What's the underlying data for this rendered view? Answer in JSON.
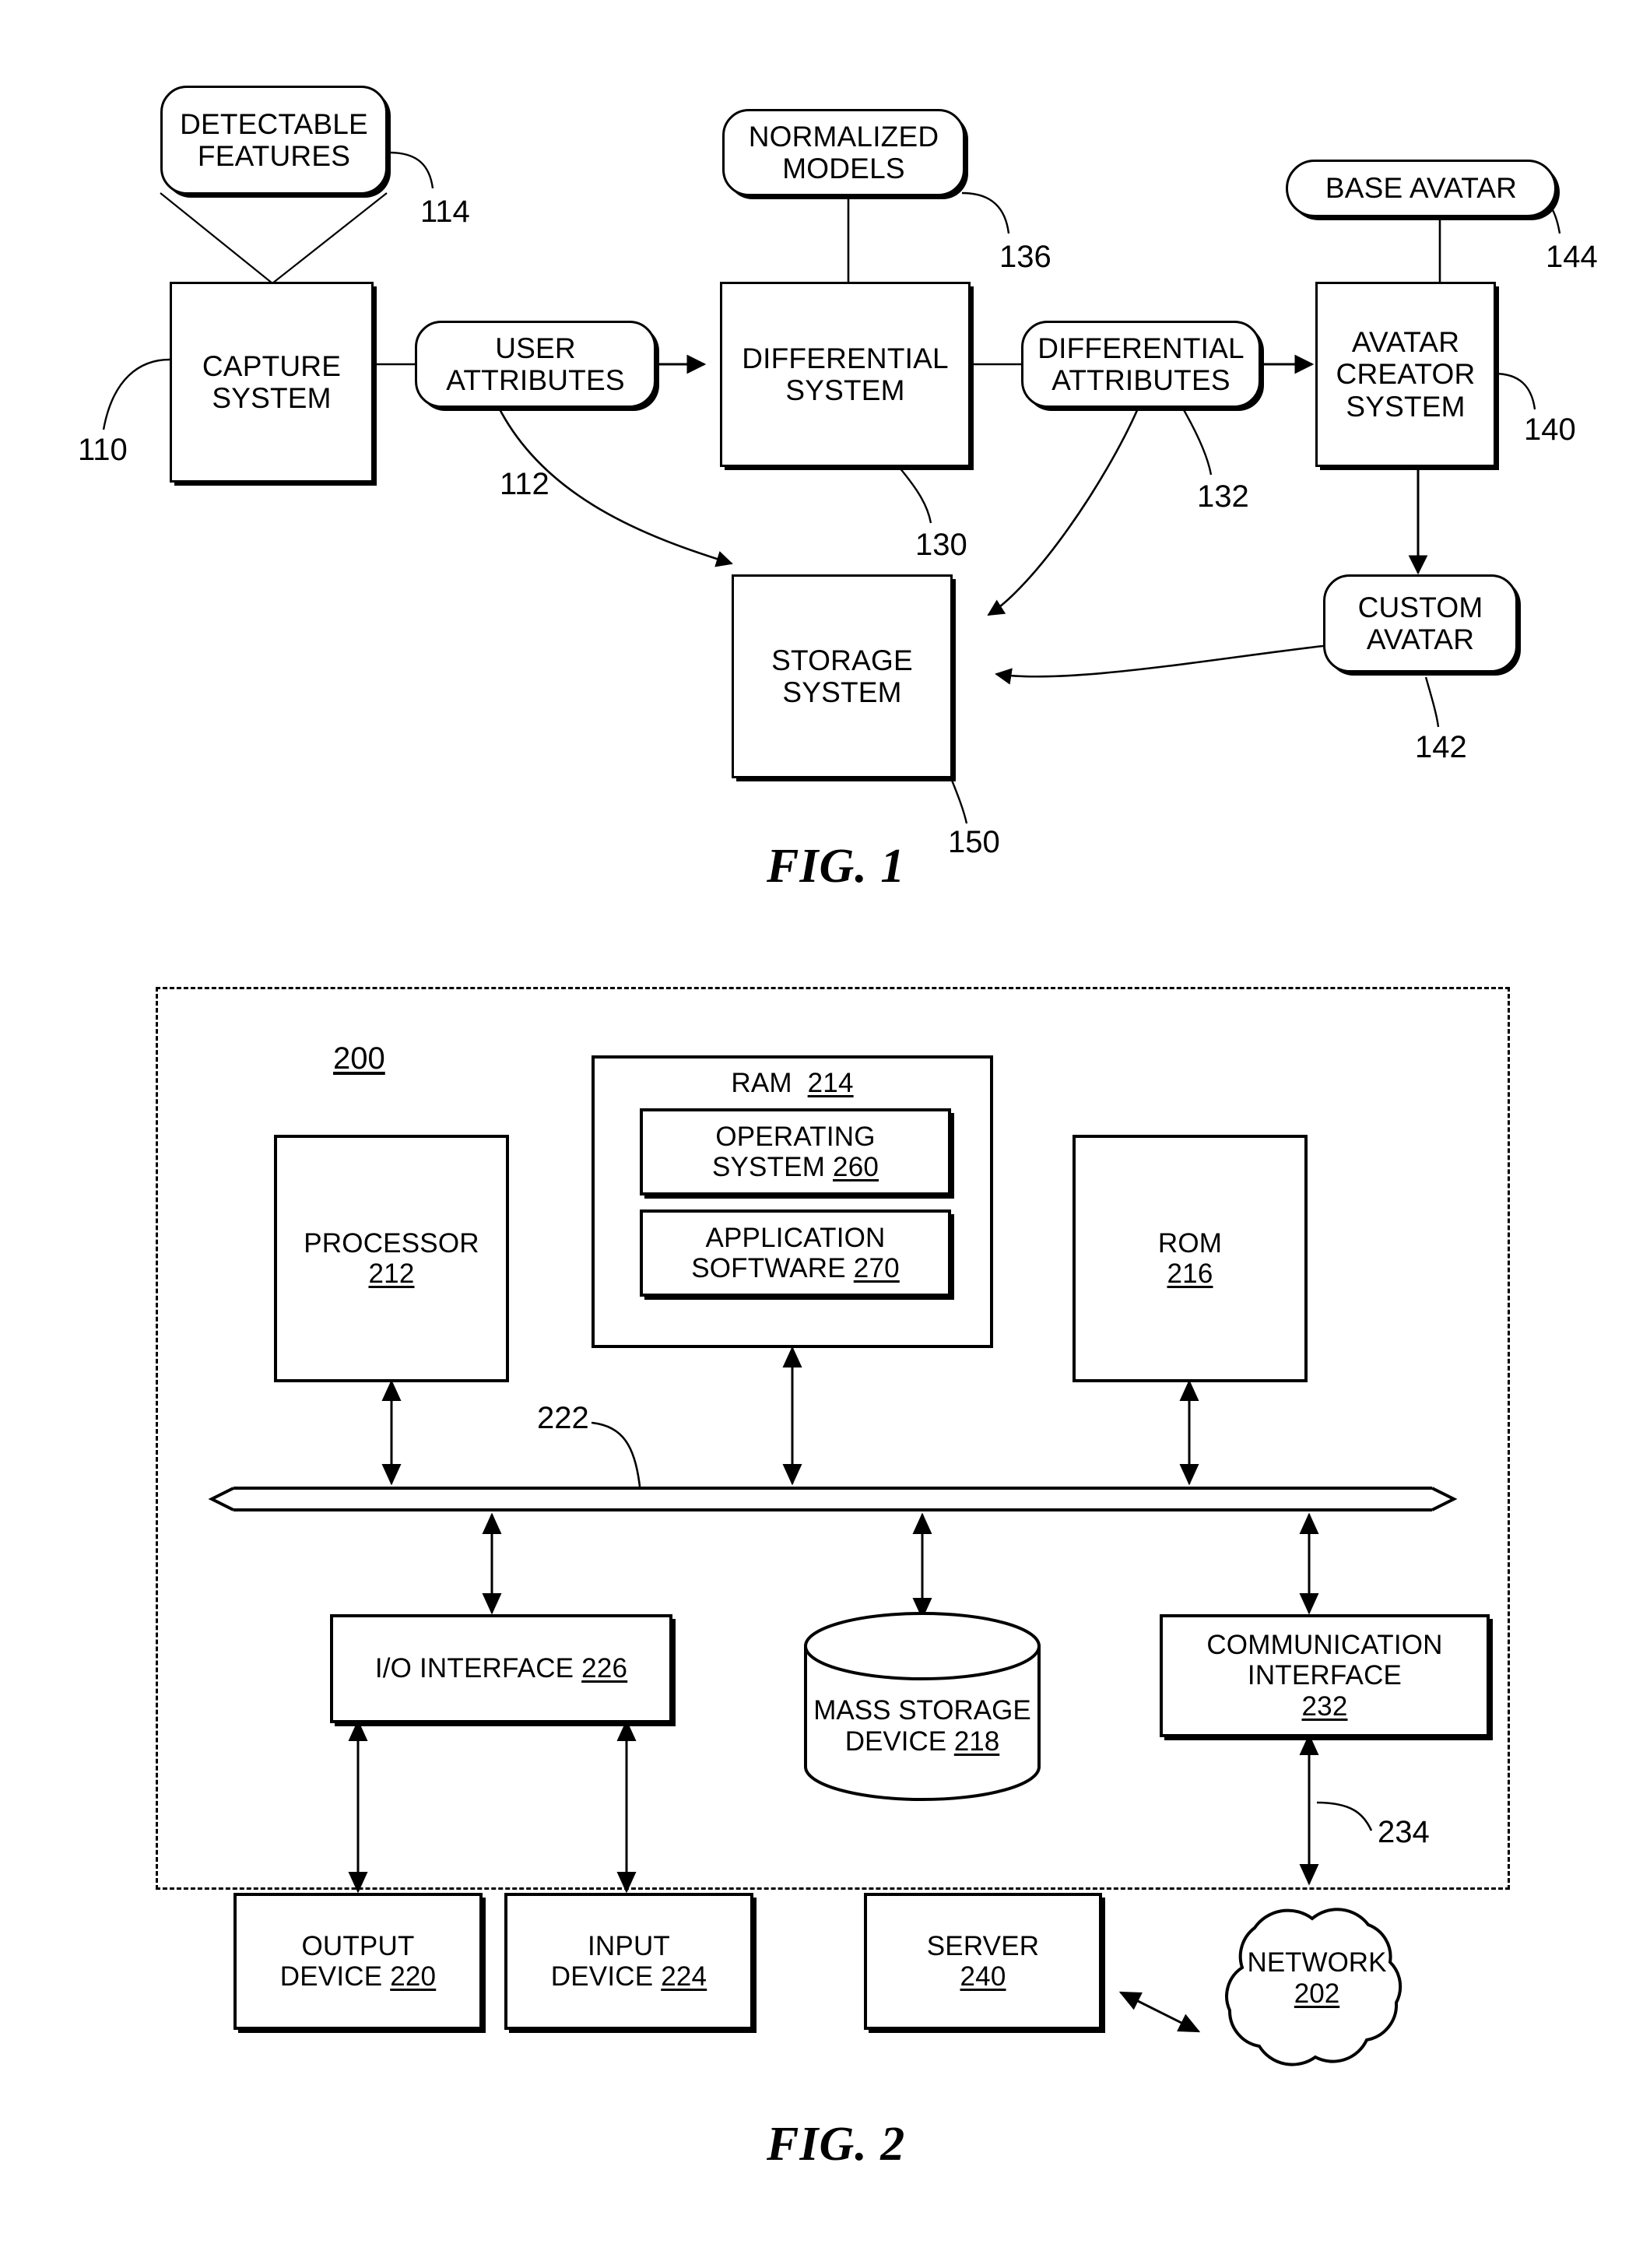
{
  "document": {
    "type": "patent-drawing-sheet",
    "figures": [
      {
        "caption": "FIG. 1",
        "title": "Avatar generation system block diagram"
      },
      {
        "caption": "FIG. 2",
        "title": "Computing device block diagram"
      }
    ]
  },
  "fig1": {
    "caption": "FIG. 1",
    "nodes": {
      "detectable_features": {
        "label": "DETECTABLE FEATURES",
        "line1": "DETECTABLE",
        "line2": "FEATURES",
        "ref": "114",
        "shape": "rounded-callout"
      },
      "capture_system": {
        "label": "CAPTURE SYSTEM",
        "line1": "CAPTURE",
        "line2": "SYSTEM",
        "ref": "110",
        "shape": "rect"
      },
      "user_attributes": {
        "label": "USER ATTRIBUTES",
        "line1": "USER",
        "line2": "ATTRIBUTES",
        "ref": "112",
        "shape": "rounded"
      },
      "normalized_models": {
        "label": "NORMALIZED MODELS",
        "line1": "NORMALIZED",
        "line2": "MODELS",
        "ref": "136",
        "shape": "rounded"
      },
      "differential_system": {
        "label": "DIFFERENTIAL SYSTEM",
        "line1": "DIFFERENTIAL",
        "line2": "SYSTEM",
        "ref": "130",
        "shape": "rect"
      },
      "differential_attributes": {
        "label": "DIFFERENTIAL ATTRIBUTES",
        "line1": "DIFFERENTIAL",
        "line2": "ATTRIBUTES",
        "ref": "132",
        "shape": "rounded"
      },
      "base_avatar": {
        "label": "BASE AVATAR",
        "line1": "BASE AVATAR",
        "line2": "",
        "ref": "144",
        "shape": "pill"
      },
      "avatar_creator_system": {
        "label": "AVATAR CREATOR SYSTEM",
        "line1": "AVATAR",
        "line2": "CREATOR",
        "line3": "SYSTEM",
        "ref": "140",
        "shape": "rect"
      },
      "custom_avatar": {
        "label": "CUSTOM AVATAR",
        "line1": "CUSTOM",
        "line2": "AVATAR",
        "ref": "142",
        "shape": "rounded"
      },
      "storage_system": {
        "label": "STORAGE SYSTEM",
        "line1": "STORAGE",
        "line2": "SYSTEM",
        "ref": "150",
        "shape": "rect"
      }
    },
    "reference_numerals": [
      "110",
      "112",
      "114",
      "130",
      "132",
      "136",
      "140",
      "142",
      "144",
      "150"
    ]
  },
  "fig2": {
    "caption": "FIG. 2",
    "enclosure_ref": "200",
    "nodes": {
      "processor": {
        "line1": "PROCESSOR",
        "ref": "212"
      },
      "ram": {
        "line1": "RAM",
        "ref": "214"
      },
      "operating_system": {
        "line1": "OPERATING",
        "line2": "SYSTEM",
        "ref": "260"
      },
      "application_software": {
        "line1": "APPLICATION",
        "line2": "SOFTWARE",
        "ref": "270"
      },
      "rom": {
        "line1": "ROM",
        "ref": "216"
      },
      "bus": {
        "ref": "222"
      },
      "io_interface": {
        "line1": "I/O INTERFACE",
        "ref": "226"
      },
      "mass_storage_device": {
        "line1": "MASS STORAGE",
        "line2": "DEVICE",
        "ref": "218"
      },
      "communication_interface": {
        "line1": "COMMUNICATION",
        "line2": "INTERFACE",
        "ref": "232"
      },
      "comm_link": {
        "ref": "234"
      },
      "output_device": {
        "line1": "OUTPUT",
        "line2": "DEVICE",
        "ref": "220"
      },
      "input_device": {
        "line1": "INPUT",
        "line2": "DEVICE",
        "ref": "224"
      },
      "server": {
        "line1": "SERVER",
        "ref": "240"
      },
      "network": {
        "line1": "NETWORK",
        "ref": "202"
      }
    },
    "reference_numerals": [
      "200",
      "202",
      "212",
      "214",
      "216",
      "218",
      "220",
      "222",
      "224",
      "226",
      "232",
      "234",
      "240",
      "260",
      "270"
    ]
  },
  "colors": {
    "ink": "#000000",
    "paper": "#ffffff"
  }
}
